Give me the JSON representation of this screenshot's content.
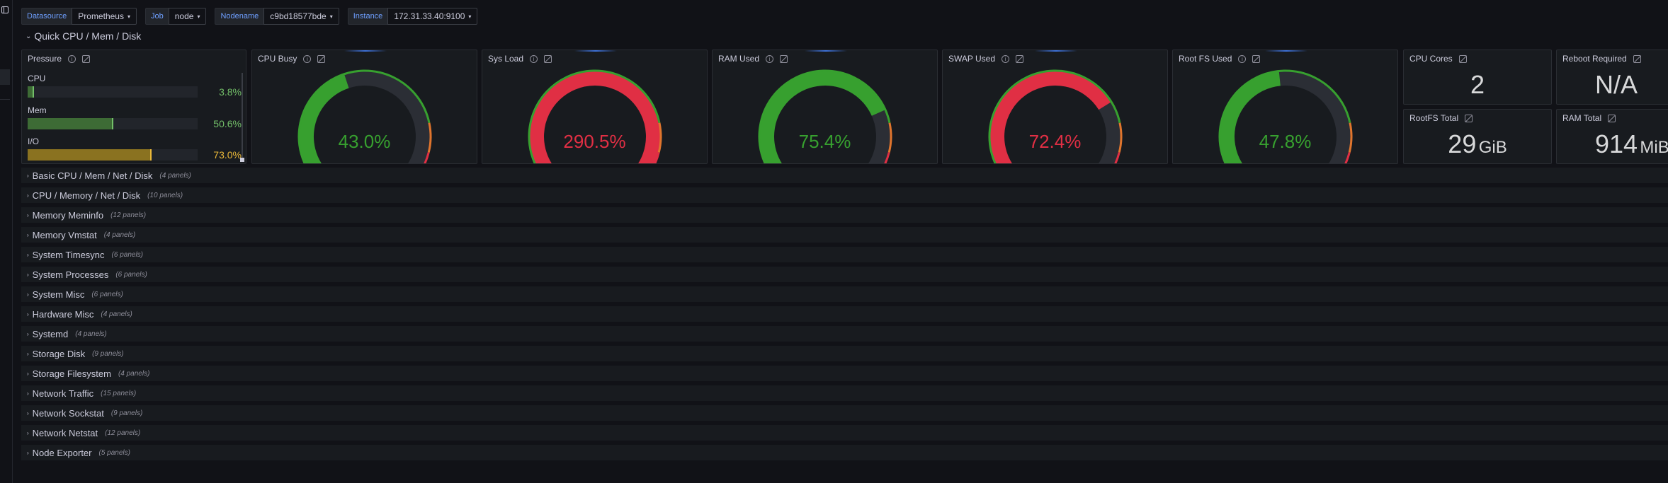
{
  "variables": [
    {
      "label": "Datasource",
      "value": "Prometheus"
    },
    {
      "label": "Job",
      "value": "node"
    },
    {
      "label": "Nodename",
      "value": "c9bd18577bde"
    },
    {
      "label": "Instance",
      "value": "172.31.33.40:9100"
    }
  ],
  "quick_row": {
    "title": "Quick CPU / Mem / Disk"
  },
  "pressure": {
    "title": "Pressure",
    "bars": [
      {
        "label": "CPU",
        "value_text": "3.8%",
        "value": 3.8,
        "color": "#73bf69"
      },
      {
        "label": "Mem",
        "value_text": "50.6%",
        "value": 50.6,
        "color": "#73bf69"
      },
      {
        "label": "I/O",
        "value_text": "73.0%",
        "value": 73.0,
        "color": "#eab839"
      }
    ]
  },
  "gauges": [
    {
      "title": "CPU Busy",
      "value_text": "43.0%",
      "value": 43.0,
      "color": "#37a02f",
      "text_color": "#37a02f"
    },
    {
      "title": "Sys Load",
      "value_text": "290.5%",
      "value": 100,
      "color": "#e02f44",
      "text_color": "#e02f44"
    },
    {
      "title": "RAM Used",
      "value_text": "75.4%",
      "value": 75.4,
      "color": "#37a02f",
      "text_color": "#37a02f"
    },
    {
      "title": "SWAP Used",
      "value_text": "72.4%",
      "value": 72.4,
      "color": "#e02f44",
      "text_color": "#e02f44"
    },
    {
      "title": "Root FS Used",
      "value_text": "47.8%",
      "value": 47.8,
      "color": "#37a02f",
      "text_color": "#37a02f"
    }
  ],
  "stats": [
    {
      "title": "CPU Cores",
      "value": "2",
      "unit": ""
    },
    {
      "title": "Reboot Required",
      "value": "N/A",
      "unit": ""
    },
    {
      "title": "RootFS Total",
      "value": "29",
      "unit": "GiB"
    },
    {
      "title": "RAM Total",
      "value": "914",
      "unit": "MiB"
    }
  ],
  "collapsed_rows": [
    {
      "title": "Basic CPU / Mem / Net / Disk",
      "count": "(4 panels)"
    },
    {
      "title": "CPU / Memory / Net / Disk",
      "count": "(10 panels)"
    },
    {
      "title": "Memory Meminfo",
      "count": "(12 panels)"
    },
    {
      "title": "Memory Vmstat",
      "count": "(4 panels)"
    },
    {
      "title": "System Timesync",
      "count": "(6 panels)"
    },
    {
      "title": "System Processes",
      "count": "(6 panels)"
    },
    {
      "title": "System Misc",
      "count": "(6 panels)"
    },
    {
      "title": "Hardware Misc",
      "count": "(4 panels)"
    },
    {
      "title": "Systemd",
      "count": "(4 panels)"
    },
    {
      "title": "Storage Disk",
      "count": "(9 panels)"
    },
    {
      "title": "Storage Filesystem",
      "count": "(4 panels)"
    },
    {
      "title": "Network Traffic",
      "count": "(15 panels)"
    },
    {
      "title": "Network Sockstat",
      "count": "(9 panels)"
    },
    {
      "title": "Network Netstat",
      "count": "(12 panels)"
    },
    {
      "title": "Node Exporter",
      "count": "(5 panels)"
    }
  ]
}
